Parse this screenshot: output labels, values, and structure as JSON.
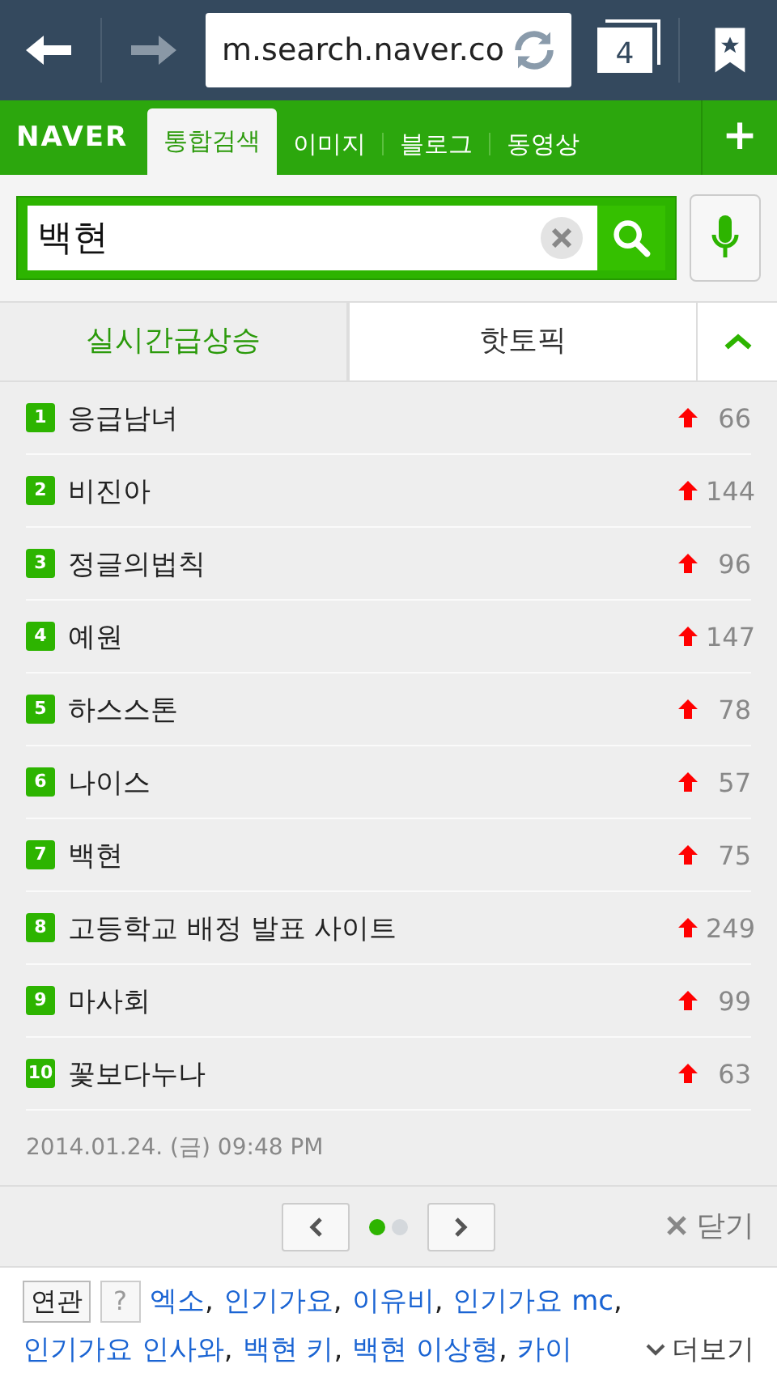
{
  "browser": {
    "url": "m.search.naver.co",
    "tab_count": "4"
  },
  "nav": {
    "logo": "NAVER",
    "tabs": [
      {
        "label": "통합검색",
        "selected": true
      },
      {
        "label": "이미지",
        "selected": false
      },
      {
        "label": "블로그",
        "selected": false
      },
      {
        "label": "동영상",
        "selected": false
      }
    ],
    "plus": "+"
  },
  "search": {
    "value": "백현"
  },
  "rank_tabs": [
    {
      "label": "실시간급상승",
      "selected": true
    },
    {
      "label": "핫토픽",
      "selected": false
    }
  ],
  "ranking": [
    {
      "rank": "1",
      "title": "응급남녀",
      "change": "66"
    },
    {
      "rank": "2",
      "title": "비진아",
      "change": "144"
    },
    {
      "rank": "3",
      "title": "정글의법칙",
      "change": "96"
    },
    {
      "rank": "4",
      "title": "예원",
      "change": "147"
    },
    {
      "rank": "5",
      "title": "하스스톤",
      "change": "78"
    },
    {
      "rank": "6",
      "title": "나이스",
      "change": "57"
    },
    {
      "rank": "7",
      "title": "백현",
      "change": "75"
    },
    {
      "rank": "8",
      "title": "고등학교 배정 발표 사이트",
      "change": "249"
    },
    {
      "rank": "9",
      "title": "마사회",
      "change": "99"
    },
    {
      "rank": "10",
      "title": "꽃보다누나",
      "change": "63"
    }
  ],
  "timestamp": "2014.01.24. (금) 09:48 PM",
  "pager": {
    "dots": [
      {
        "selected": true
      },
      {
        "selected": false
      }
    ],
    "close": "닫기"
  },
  "related": {
    "label": "연관",
    "help": "?",
    "keywords": [
      {
        "text": "엑소",
        "sep": ","
      },
      {
        "text": "인기가요",
        "sep": ","
      },
      {
        "text": "이유비",
        "sep": ","
      },
      {
        "text": "인기가요 mc",
        "sep": ","
      },
      {
        "text": "인기가요 인사와",
        "sep": ","
      },
      {
        "text": "백현 키",
        "sep": ","
      },
      {
        "text": "백현 이상형",
        "sep": ","
      },
      {
        "text": "카이"
      }
    ],
    "more": "더보기"
  }
}
